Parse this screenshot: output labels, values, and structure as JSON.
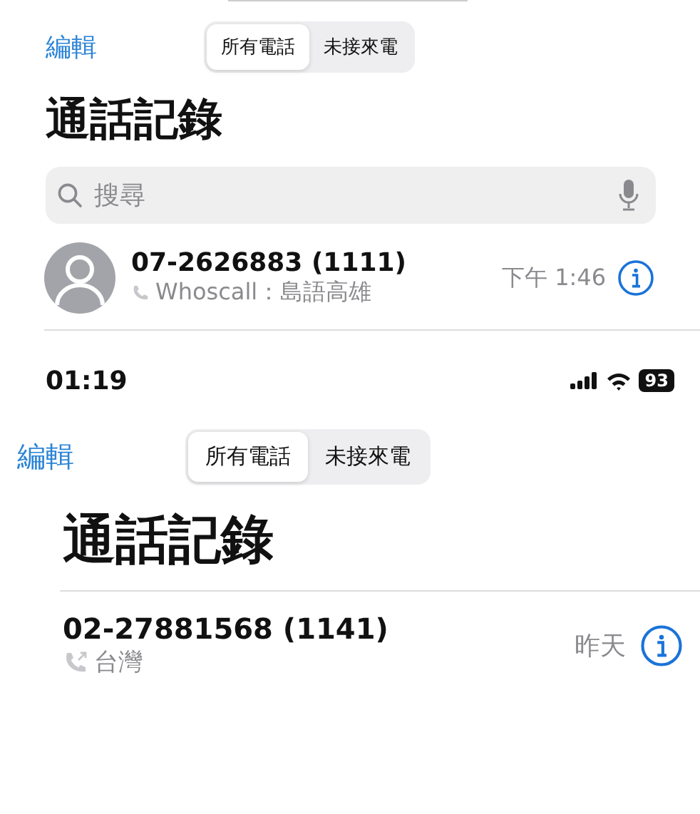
{
  "screens": [
    {
      "edit": "編輯",
      "segments": [
        {
          "label": "所有電話",
          "selected": true
        },
        {
          "label": "未接來電",
          "selected": false
        }
      ],
      "title": "通話記錄",
      "search": {
        "placeholder": "搜尋"
      },
      "calls": [
        {
          "number": "07-2626883 (1111)",
          "detail": "Whoscall：島語高雄",
          "time": "下午 1:46",
          "avatar": true,
          "outgoing": false
        }
      ]
    },
    {
      "status_bar": {
        "time": "01:19",
        "battery": "93"
      },
      "edit": "編輯",
      "segments": [
        {
          "label": "所有電話",
          "selected": true
        },
        {
          "label": "未接來電",
          "selected": false
        }
      ],
      "title": "通話記錄",
      "calls": [
        {
          "number": "02-27881568 (1141)",
          "detail": "台灣",
          "time": "昨天",
          "avatar": false,
          "outgoing": true
        }
      ]
    }
  ]
}
